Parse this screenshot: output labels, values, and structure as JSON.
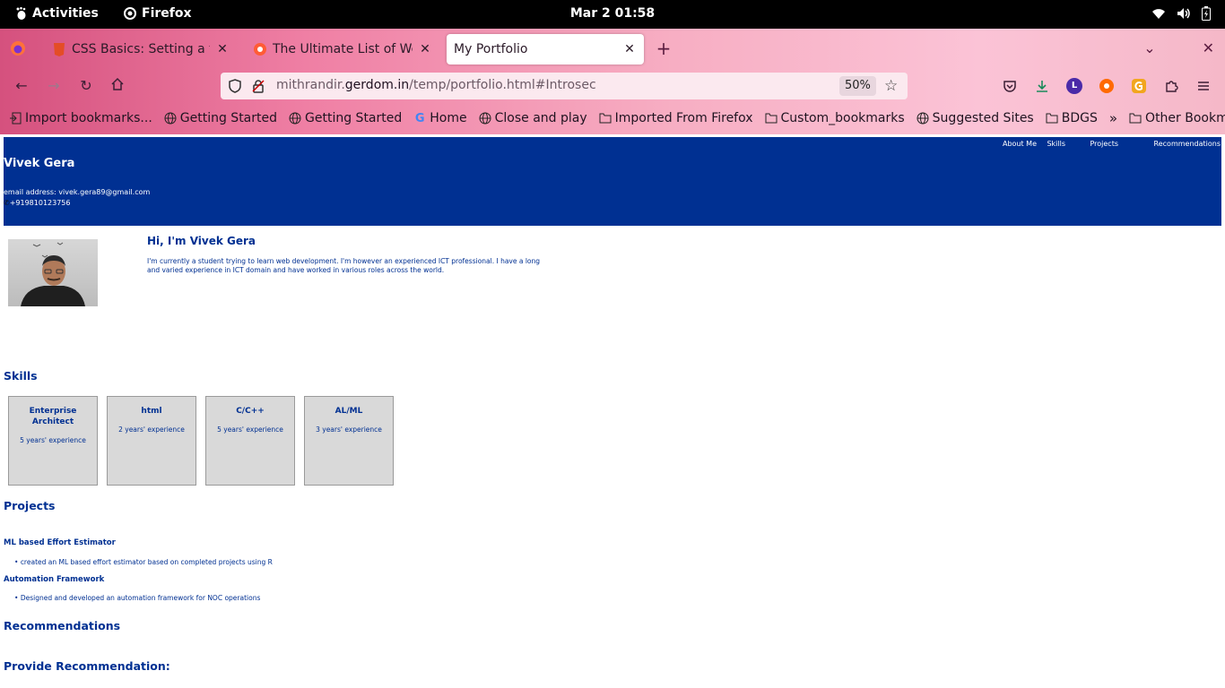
{
  "topbar": {
    "activities": "Activities",
    "app_name": "Firefox",
    "clock": "Mar 2  01:58"
  },
  "browser": {
    "tabs": [
      {
        "title": "CSS Basics: Setting a table",
        "active": false
      },
      {
        "title": "The Ultimate List of Web-Safe",
        "active": false
      },
      {
        "title": "My Portfolio",
        "active": true
      }
    ],
    "url_prefix": "mithrandir.",
    "url_domain": "gerdom.in",
    "url_path": "/temp/portfolio.html#Introsec",
    "zoom": "50%",
    "bookmarks": [
      {
        "label": "Import bookmarks...",
        "icon": "import-icon"
      },
      {
        "label": "Getting Started",
        "icon": "globe-icon"
      },
      {
        "label": "Getting Started",
        "icon": "globe-icon"
      },
      {
        "label": "Home",
        "icon": "google-icon"
      },
      {
        "label": "Close and play",
        "icon": "globe-icon"
      },
      {
        "label": "Imported From Firefox",
        "icon": "folder-icon"
      },
      {
        "label": "Custom_bookmarks",
        "icon": "folder-icon"
      },
      {
        "label": "Suggested Sites",
        "icon": "globe-icon"
      },
      {
        "label": "BDGS",
        "icon": "folder-icon"
      }
    ],
    "other_bookmarks": "Other Bookmarks",
    "account_initial": "L"
  },
  "page": {
    "header": {
      "name": "Vivek Gera",
      "email": "email address: vivek.gera89@gmail.com",
      "phone": "+919810123756",
      "nav": [
        "About Me",
        "Skills",
        "Projects",
        "Recommendations"
      ]
    },
    "intro": {
      "heading": "Hi, I'm Vivek Gera",
      "text": "I'm currently a student trying to learn web development. I'm however an experienced ICT professional. I have a long and varied experience in ICT domain and have worked in various roles across the world."
    },
    "skills_heading": "Skills",
    "skills": [
      {
        "title": "Enterprise Architect",
        "experience": "5 years' experience"
      },
      {
        "title": "html",
        "experience": "2 years' experience"
      },
      {
        "title": "C/C++",
        "experience": "5 years' experience"
      },
      {
        "title": "AL/ML",
        "experience": "3 years' experience"
      }
    ],
    "projects_heading": "Projects",
    "projects": [
      {
        "title": "ML based Effort Estimator",
        "item": "created an ML based effort estimator based on completed projects using R"
      },
      {
        "title": "Automation Framework",
        "item": "Designed and developed an automation framework for NOC operations"
      }
    ],
    "recommendations_heading": "Recommendations",
    "provide_recommendation_heading": "Provide Recommendation:"
  }
}
